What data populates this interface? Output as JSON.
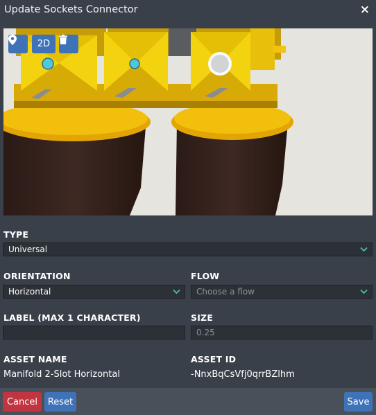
{
  "dialog": {
    "title": "Update Sockets Connector",
    "close_glyph": "×"
  },
  "toolbar": {
    "location_icon": "map-marker-icon",
    "view_2d_label": "2D",
    "delete_icon": "trash-icon"
  },
  "form": {
    "type": {
      "label": "TYPE",
      "value": "Universal"
    },
    "orientation": {
      "label": "ORIENTATION",
      "value": "Horizontal"
    },
    "flow": {
      "label": "FLOW",
      "placeholder": "Choose a flow",
      "value": ""
    },
    "label_field": {
      "label": "LABEL (MAX 1 CHARACTER)",
      "value": ""
    },
    "size": {
      "label": "SIZE",
      "placeholder": "0.25",
      "value": ""
    },
    "asset_name": {
      "label": "ASSET NAME",
      "value": "Manifold 2-Slot Horizontal"
    },
    "asset_id": {
      "label": "ASSET ID",
      "value": "-NnxBqCsVfj0qrrBZlhm"
    }
  },
  "footer": {
    "cancel_label": "Cancel",
    "reset_label": "Reset",
    "save_label": "Save"
  },
  "colors": {
    "background": "#3a4049",
    "footer": "#4a5059",
    "primary": "#3f73b8",
    "danger": "#c0353f",
    "chevron": "#4fc3a1",
    "socket_yellow": "#f2c40f"
  }
}
